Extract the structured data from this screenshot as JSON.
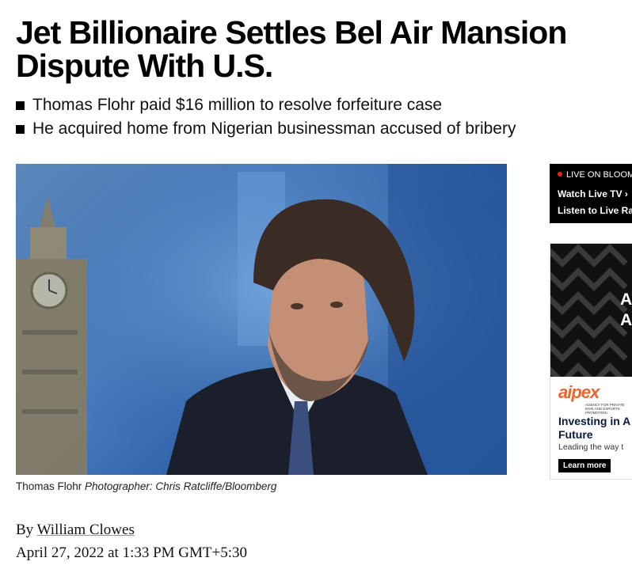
{
  "article": {
    "headline": "Jet Billionaire Settles Bel Air Mansion Dispute With U.S.",
    "bullets": [
      "Thomas Flohr paid $16 million to resolve forfeiture case",
      "He acquired home from Nigerian businessman accused of bribery"
    ],
    "photo": {
      "caption_subject": "Thomas Flohr",
      "caption_credit": "Photographer: Chris Ratcliffe/Bloomberg"
    },
    "byline": {
      "prefix": "By",
      "author": "William Clowes"
    },
    "date": "April 27, 2022 at 1:33 PM GMT+5:30"
  },
  "live_widget": {
    "live_label": "LIVE ON BLOOM",
    "watch_label": "Watch Live TV",
    "listen_label": "Listen to Live Ra",
    "accent_color": "#e5231b"
  },
  "ad": {
    "big_text_line1": "A",
    "big_text_line2": "A",
    "logo": "aipex",
    "logo_sub": "AGENCY FOR PRIVATE INVE AND EXPORTS PROMOTION",
    "title_line1": "Investing in A",
    "title_line2": "Future",
    "subtitle": "Leading the way t",
    "button": "Learn more",
    "brand_color": "#f0642a"
  }
}
